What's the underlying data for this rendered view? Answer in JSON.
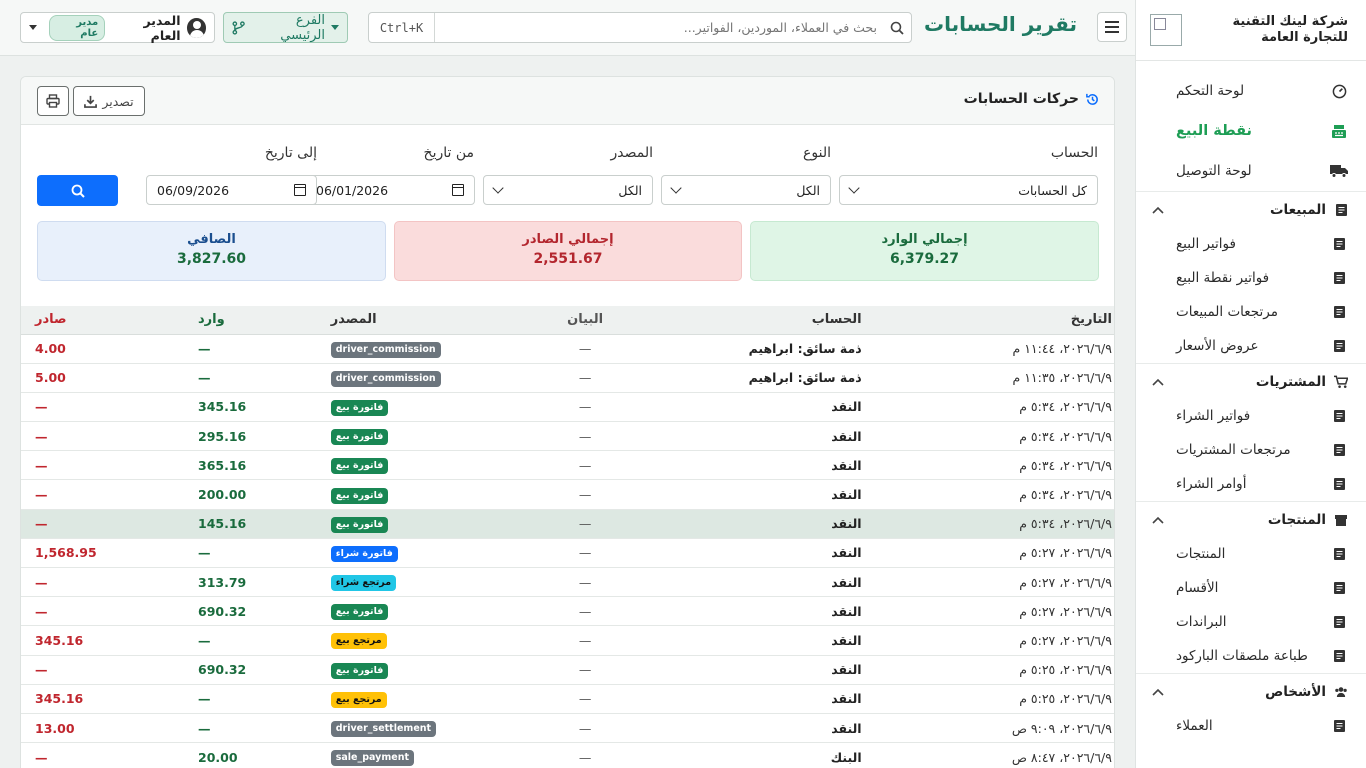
{
  "company": {
    "name": "شركة لينك التقنية للتجارة العامة"
  },
  "sidebar": {
    "main": [
      {
        "label": "لوحة التحكم",
        "icon": "gauge-icon"
      },
      {
        "label": "نقطة البيع",
        "icon": "cash-register-icon",
        "active": true
      },
      {
        "label": "لوحة التوصيل",
        "icon": "truck-icon"
      }
    ],
    "groups": [
      {
        "label": "المبيعات",
        "items": [
          "فواتير البيع",
          "فواتير نقطة البيع",
          "مرتجعات المبيعات",
          "عروض الأسعار"
        ]
      },
      {
        "label": "المشتريات",
        "items": [
          "فواتير الشراء",
          "مرتجعات المشتريات",
          "أوامر الشراء"
        ]
      },
      {
        "label": "المنتجات",
        "items": [
          "المنتجات",
          "الأقسام",
          "البراندات",
          "طباعة ملصقات الباركود"
        ]
      },
      {
        "label": "الأشخاص",
        "items": [
          "العملاء"
        ]
      }
    ]
  },
  "topbar": {
    "title": "تقرير الحسابات",
    "search_placeholder": "بحث في العملاء، الموردين، الفواتير...",
    "search_shortcut": "Ctrl+K",
    "branch": "الفرع الرئيسي",
    "user_name": "المدير العام",
    "user_role": "مدير عام"
  },
  "card": {
    "title": "حركات الحسابات",
    "export_label": "تصدير"
  },
  "filters": {
    "account_label": "الحساب",
    "account_value": "كل الحسابات",
    "type_label": "النوع",
    "type_value": "الكل",
    "source_label": "المصدر",
    "source_value": "الكل",
    "from_label": "من تاريخ",
    "from_value": "06/01/2026",
    "to_label": "إلى تاريخ",
    "to_value": "06/09/2026"
  },
  "summary": {
    "in_label": "إجمالي الوارد",
    "in_value": "6,379.27",
    "out_label": "إجمالي الصادر",
    "out_value": "2,551.67",
    "net_label": "الصافي",
    "net_value": "3,827.60"
  },
  "table": {
    "headers": {
      "date": "التاريخ",
      "account": "الحساب",
      "desc": "البيان",
      "source": "المصدر",
      "in": "وارد",
      "out": "صادر"
    },
    "rows": [
      {
        "date": "٢٠٢٦/٦/٩، ١١:٤٤ م",
        "account": "ذمة سائق: ابراهيم",
        "desc": "—",
        "source": "driver_commission",
        "badge": "gray",
        "in": "—",
        "out": "4.00"
      },
      {
        "date": "٢٠٢٦/٦/٩، ١١:٣٥ م",
        "account": "ذمة سائق: ابراهيم",
        "desc": "—",
        "source": "driver_commission",
        "badge": "gray",
        "in": "—",
        "out": "5.00"
      },
      {
        "date": "٢٠٢٦/٦/٩، ٥:٣٤ م",
        "account": "النقد",
        "desc": "—",
        "source": "فاتورة بيع",
        "badge": "green",
        "in": "345.16",
        "out": "—"
      },
      {
        "date": "٢٠٢٦/٦/٩، ٥:٣٤ م",
        "account": "النقد",
        "desc": "—",
        "source": "فاتورة بيع",
        "badge": "green",
        "in": "295.16",
        "out": "—"
      },
      {
        "date": "٢٠٢٦/٦/٩، ٥:٣٤ م",
        "account": "النقد",
        "desc": "—",
        "source": "فاتورة بيع",
        "badge": "green",
        "in": "365.16",
        "out": "—"
      },
      {
        "date": "٢٠٢٦/٦/٩، ٥:٣٤ م",
        "account": "النقد",
        "desc": "—",
        "source": "فاتورة بيع",
        "badge": "green",
        "in": "200.00",
        "out": "—"
      },
      {
        "date": "٢٠٢٦/٦/٩، ٥:٣٤ م",
        "account": "النقد",
        "desc": "—",
        "source": "فاتورة بيع",
        "badge": "green",
        "in": "145.16",
        "out": "—",
        "highlight": true
      },
      {
        "date": "٢٠٢٦/٦/٩، ٥:٢٧ م",
        "account": "النقد",
        "desc": "—",
        "source": "فاتورة شراء",
        "badge": "blue",
        "in": "—",
        "out": "1,568.95"
      },
      {
        "date": "٢٠٢٦/٦/٩، ٥:٢٧ م",
        "account": "النقد",
        "desc": "—",
        "source": "مرتجع شراء",
        "badge": "cyan",
        "in": "313.79",
        "out": "—"
      },
      {
        "date": "٢٠٢٦/٦/٩، ٥:٢٧ م",
        "account": "النقد",
        "desc": "—",
        "source": "فاتورة بيع",
        "badge": "green",
        "in": "690.32",
        "out": "—"
      },
      {
        "date": "٢٠٢٦/٦/٩، ٥:٢٧ م",
        "account": "النقد",
        "desc": "—",
        "source": "مرتجع بيع",
        "badge": "yellow",
        "in": "—",
        "out": "345.16"
      },
      {
        "date": "٢٠٢٦/٦/٩، ٥:٢٥ م",
        "account": "النقد",
        "desc": "—",
        "source": "فاتورة بيع",
        "badge": "green",
        "in": "690.32",
        "out": "—"
      },
      {
        "date": "٢٠٢٦/٦/٩، ٥:٢٥ م",
        "account": "النقد",
        "desc": "—",
        "source": "مرتجع بيع",
        "badge": "yellow",
        "in": "—",
        "out": "345.16"
      },
      {
        "date": "٢٠٢٦/٦/٩، ٩:٠٩ ص",
        "account": "النقد",
        "desc": "—",
        "source": "driver_settlement",
        "badge": "gray",
        "in": "—",
        "out": "13.00"
      },
      {
        "date": "٢٠٢٦/٦/٩، ٨:٤٧ ص",
        "account": "البنك",
        "desc": "—",
        "source": "sale_payment",
        "badge": "gray",
        "in": "20.00",
        "out": "—"
      }
    ]
  },
  "colors": {
    "accent": "#1f7a63",
    "active_nav": "#1e9e55",
    "primary": "#0d6efd"
  }
}
